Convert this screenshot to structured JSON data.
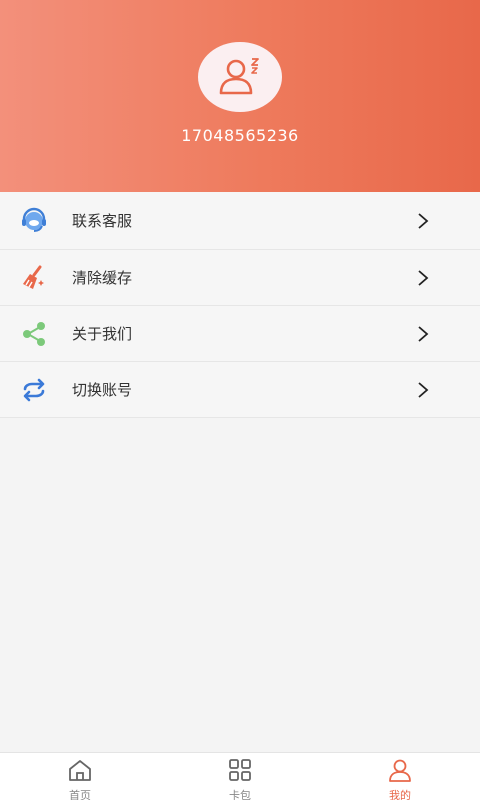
{
  "profile": {
    "phone": "17048565236"
  },
  "menu": {
    "items": [
      {
        "label": "联系客服",
        "icon": "customer-service-icon",
        "color": "#4a8fe0"
      },
      {
        "label": "清除缓存",
        "icon": "broom-icon",
        "color": "#e8684a"
      },
      {
        "label": "关于我们",
        "icon": "share-icon",
        "color": "#7cc97a"
      },
      {
        "label": "切换账号",
        "icon": "switch-icon",
        "color": "#3b7ad8"
      }
    ]
  },
  "tabbar": {
    "tabs": [
      {
        "label": "首页",
        "icon": "home-icon",
        "active": false
      },
      {
        "label": "卡包",
        "icon": "grid-icon",
        "active": false
      },
      {
        "label": "我的",
        "icon": "user-icon",
        "active": true
      }
    ]
  },
  "colors": {
    "accent": "#e8684a",
    "header_start": "#f3907b",
    "header_end": "#e8684a"
  }
}
